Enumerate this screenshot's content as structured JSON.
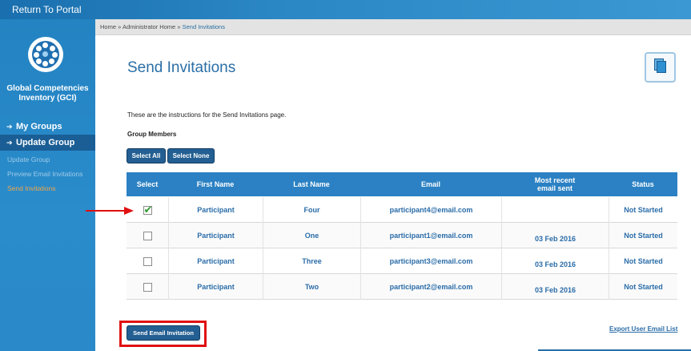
{
  "topbar": {
    "return_label": "Return To Portal"
  },
  "sidebar": {
    "app_title_line1": "Global Competencies",
    "app_title_line2": "Inventory (GCI)",
    "nav": [
      {
        "label": "My Groups",
        "active": false
      },
      {
        "label": "Update Group",
        "active": true
      }
    ],
    "sub_items": [
      {
        "label": "Update Group",
        "current": false
      },
      {
        "label": "Preview Email Invitations",
        "current": false
      },
      {
        "label": "Send Invitations",
        "current": true
      }
    ]
  },
  "breadcrumb": {
    "items": [
      "Home",
      "Administrator Home",
      "Send Invitations"
    ],
    "separator": "»"
  },
  "page": {
    "title": "Send Invitations",
    "instructions": "These are the instructions for the Send Invitations page.",
    "group_label": "Group Members",
    "select_all_label": "Select All",
    "select_none_label": "Select None",
    "send_button_label": "Send Email Invitation",
    "export_link_label": "Export User Email List"
  },
  "table": {
    "columns": [
      "Select",
      "First Name",
      "Last Name",
      "Email",
      "Most recent email sent",
      "Status"
    ],
    "rows": [
      {
        "checked": true,
        "first_name": "Participant",
        "last_name": "Four",
        "email": "participant4@email.com",
        "last_sent": "",
        "status": "Not Started"
      },
      {
        "checked": false,
        "first_name": "Participant",
        "last_name": "One",
        "email": "participant1@email.com",
        "last_sent": "03 Feb 2016",
        "status": "Not Started"
      },
      {
        "checked": false,
        "first_name": "Participant",
        "last_name": "Three",
        "email": "participant3@email.com",
        "last_sent": "03 Feb 2016",
        "status": "Not Started"
      },
      {
        "checked": false,
        "first_name": "Participant",
        "last_name": "Two",
        "email": "participant2@email.com",
        "last_sent": "03 Feb 2016",
        "status": "Not Started"
      }
    ]
  },
  "colors": {
    "accent": "#2b81c3",
    "annotation": "#e01010",
    "link": "#2a6ca8",
    "highlight_nav": "#f0a64a"
  }
}
